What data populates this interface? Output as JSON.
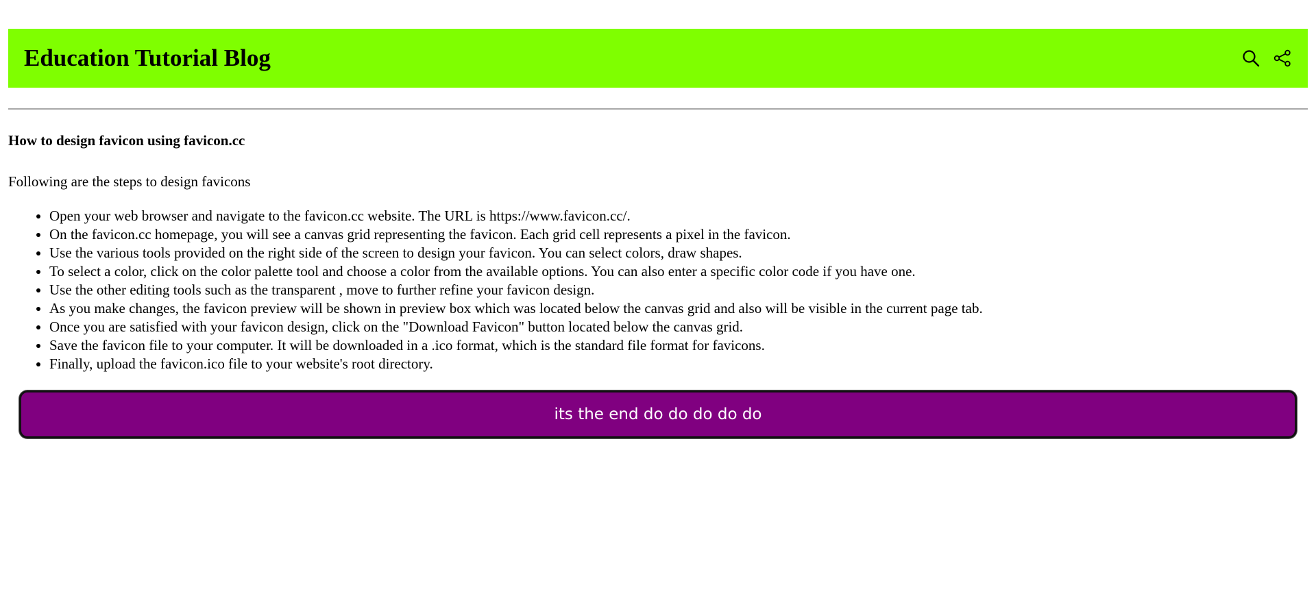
{
  "header": {
    "title": "Education Tutorial Blog",
    "background_color": "#7fff00",
    "actions": [
      {
        "icon": "search-icon"
      },
      {
        "icon": "share-icon"
      }
    ]
  },
  "article": {
    "title": "How to design favicon using favicon.cc",
    "intro": "Following are the steps to design favicons",
    "steps": [
      "Open your web browser and navigate to the favicon.cc website. The URL is https://www.favicon.cc/.",
      "On the favicon.cc homepage, you will see a canvas grid representing the favicon. Each grid cell represents a pixel in the favicon.",
      "Use the various tools provided on the right side of the screen to design your favicon. You can select colors, draw shapes.",
      "To select a color, click on the color palette tool and choose a color from the available options. You can also enter a specific color code if you have one.",
      "Use the other editing tools such as the transparent , move to further refine your favicon design.",
      "As you make changes, the favicon preview will be shown in preview box which was located below the canvas grid and also will be visible in the current page tab.",
      "Once you are satisfied with your favicon design, click on the \"Download Favicon\" button located below the canvas grid.",
      "Save the favicon file to your computer. It will be downloaded in a .ico format, which is the standard file format for favicons.",
      "Finally, upload the favicon.ico file to your website's root directory."
    ]
  },
  "end_button": {
    "label": "its the end do do do do do",
    "background_color": "#800080"
  }
}
